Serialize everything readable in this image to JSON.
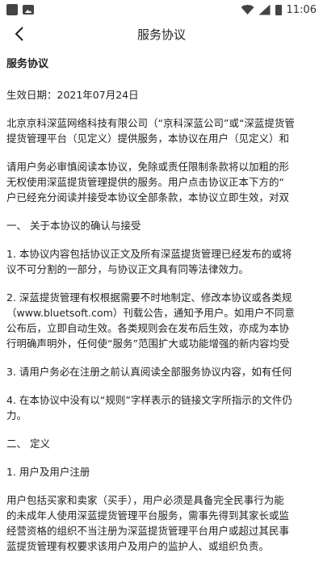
{
  "statusbar": {
    "time": "11:06"
  },
  "header": {
    "title": "服务协议"
  },
  "doc": {
    "title": "服务协议",
    "effective_date": "生效日期：2021年07月24日",
    "p1": [
      "北京京科深蓝网络科技有限公司（“京科深蓝公司”或“深蓝提货管",
      "提货管理平台（见定义）提供服务，本协议在用户（见定义）和"
    ],
    "p2": [
      "请用户务必审慎阅读本协议，免除或责任限制条款将以加粗的形",
      "无权使用深蓝提货管理提供的服务。用户点击协议正本下方的“",
      "户已经充分阅读并接受本协议全部条款，本协议立即生效，对双"
    ],
    "s1": "一、 关于本协议的确认与接受",
    "i1": [
      "1. 本协议内容包括协议正文及所有深蓝提货管理已经发布的或将",
      "议不可分割的一部分，与协议正文具有同等法律效力。"
    ],
    "i2": [
      "2. 深蓝提货管理有权根据需要不时地制定、修改本协议或各类规",
      "（www.bluetsoft.com）刊载公告，通知予用户。如用户不同意",
      "公布后，立即自动生效。各类规则会在发布后生效，亦成为本协",
      "行明确声明外，任何使“服务”范围扩大或功能增强的新内容均受"
    ],
    "i3": "3. 请用户务必在注册之前认真阅读全部服务协议内容，如有任何",
    "i4": [
      "4. 在本协议中没有以“规则”字样表示的链接文字所指示的文件仍",
      "力。"
    ],
    "s2": "二、 定义",
    "s2_1": "1. 用户及用户注册",
    "p3": [
      "用户包括买家和卖家（买手），用户必须是具备完全民事行为能",
      "的未成年人使用深蓝提货管理平台服务，需事先得到其家长或监",
      "经营资格的组织不当注册为深蓝提货管理平台用户或超过其民事",
      "蓝提货管理有权要求该用户及用户的监护人、或组织负责。"
    ]
  }
}
